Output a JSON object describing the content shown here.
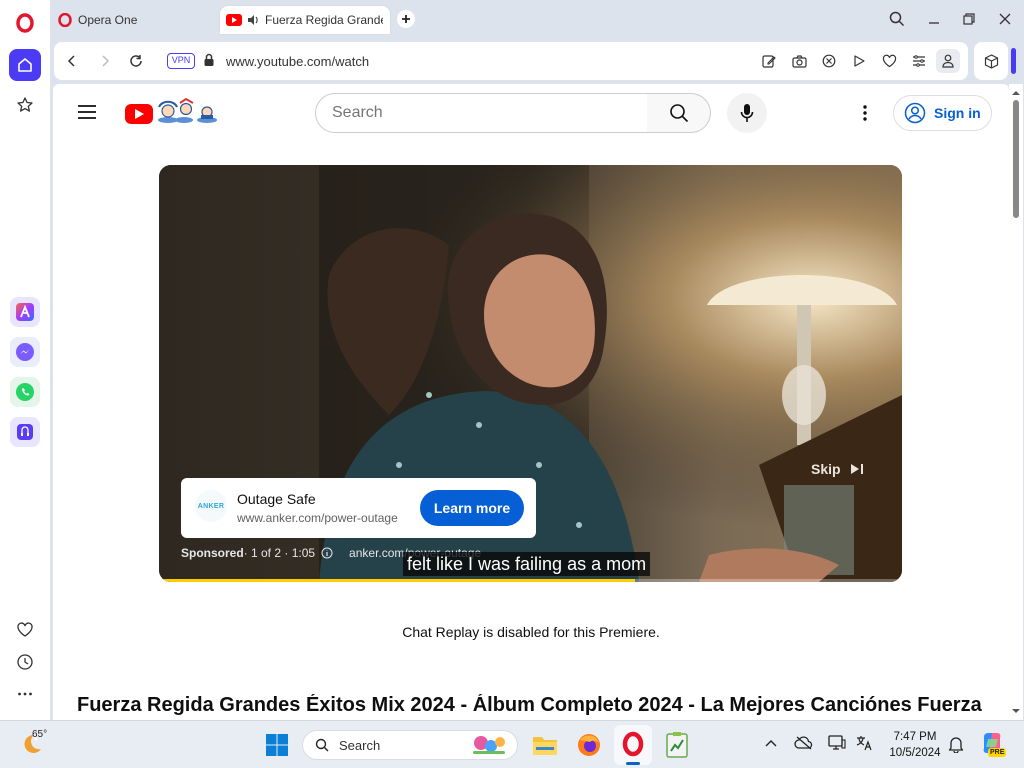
{
  "browser": {
    "brand_tab_label": "Opera One",
    "active_tab_label": "Fuerza Regida Grande",
    "url": "www.youtube.com/watch",
    "vpn_label": "VPN"
  },
  "youtube": {
    "search_placeholder": "Search",
    "sign_in_label": "Sign in"
  },
  "ad": {
    "title": "Outage Safe",
    "url": "www.anker.com/power-outage",
    "learn_more": "Learn more",
    "skip_label": "Skip",
    "sponsored_label": "Sponsored",
    "sponsored_meta": " · 1 of 2 · 1:05",
    "ad_domain": "anker.com/power-outage",
    "logo_text": "ANKER",
    "caption": "felt like I was failing as a mom",
    "progress": 0.64
  },
  "chat_replay_text": "Chat Replay is disabled for this Premiere.",
  "video_title": "Fuerza Regida Grandes Éxitos Mix 2024 - Álbum Completo 2024 - La Mejores Canciónes Fuerza",
  "taskbar": {
    "weather_temp": "65°",
    "search_label": "Search",
    "time": "7:47 PM",
    "date": "10/5/2024",
    "copilot_badge": "PRE"
  },
  "colors": {
    "accent": "#3a3aff",
    "yt_red": "#ff0000",
    "learn_more_bg": "#065fd4",
    "progress": "#ffcc00"
  }
}
